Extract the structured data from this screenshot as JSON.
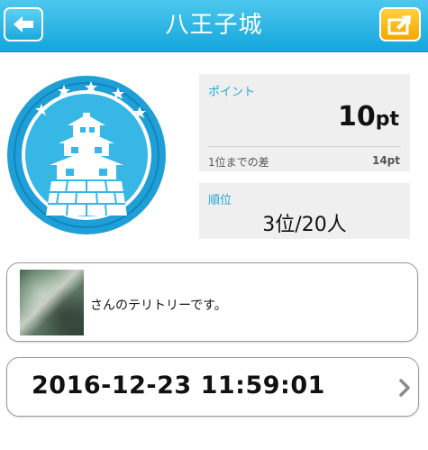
{
  "header": {
    "title": "八王子城",
    "back_icon": "back-arrow-icon",
    "share_icon": "share-arrow-icon",
    "colors": {
      "bar": "#1ba9de",
      "share": "#f5b400"
    }
  },
  "emblem": {
    "icon": "castle-emblem-icon",
    "stars": 5,
    "color": "#1f9fd6"
  },
  "points": {
    "label": "ポイント",
    "value": "10",
    "unit": "pt",
    "diff_label": "1位までの差",
    "diff_value": "14pt"
  },
  "rank": {
    "label": "順位",
    "value": "3位/20人"
  },
  "territory": {
    "text": "さんのテリトリーです。"
  },
  "datetime": {
    "value": "2016-12-23 11:59:01",
    "chevron_icon": "chevron-right-icon"
  }
}
